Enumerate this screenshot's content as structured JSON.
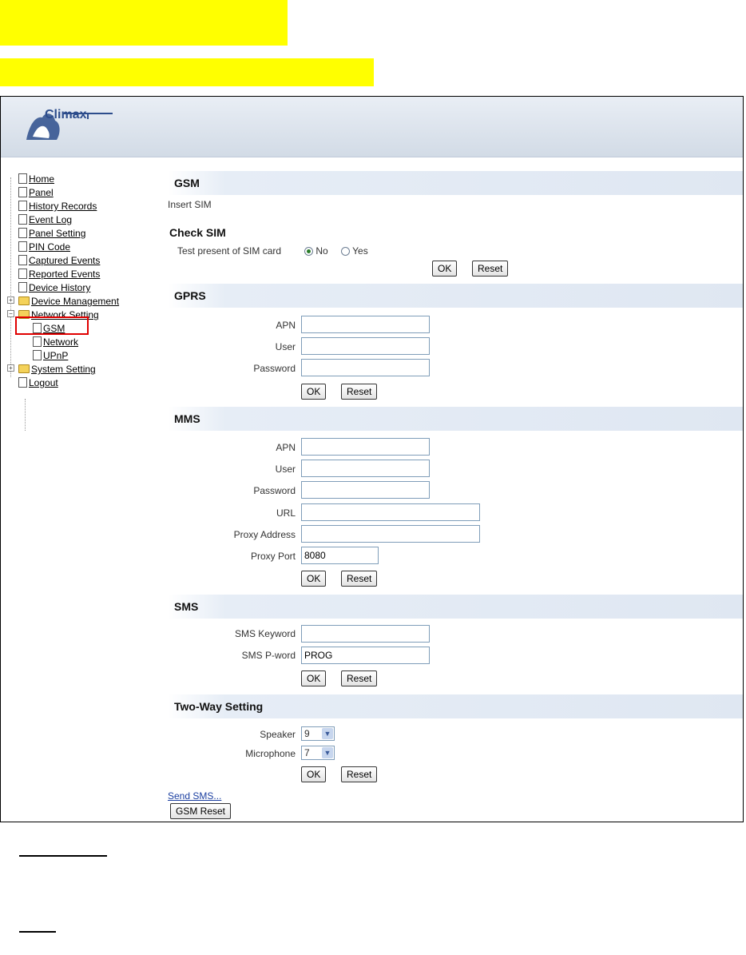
{
  "brand": {
    "name": "Climax"
  },
  "nav": {
    "items": [
      {
        "label": "Home"
      },
      {
        "label": "Panel"
      },
      {
        "label": "History Records"
      },
      {
        "label": "Event Log"
      },
      {
        "label": "Panel Setting"
      },
      {
        "label": "PIN Code"
      },
      {
        "label": "Captured Events"
      },
      {
        "label": "Reported Events"
      },
      {
        "label": "Device History"
      },
      {
        "label": "Device Management"
      },
      {
        "label": "Network Setting"
      },
      {
        "label": "GSM"
      },
      {
        "label": "Network"
      },
      {
        "label": "UPnP"
      },
      {
        "label": "System Setting"
      },
      {
        "label": "Logout"
      }
    ]
  },
  "gsm": {
    "title": "GSM",
    "insert_sim": "Insert SIM",
    "check_sim_title": "Check SIM",
    "test_label": "Test present of SIM card",
    "radio_no": "No",
    "radio_yes": "Yes",
    "ok": "OK",
    "reset": "Reset"
  },
  "gprs": {
    "title": "GPRS",
    "apn_label": "APN",
    "apn_value": "",
    "user_label": "User",
    "user_value": "",
    "password_label": "Password",
    "password_value": "",
    "ok": "OK",
    "reset": "Reset"
  },
  "mms": {
    "title": "MMS",
    "apn_label": "APN",
    "apn_value": "",
    "user_label": "User",
    "user_value": "",
    "password_label": "Password",
    "password_value": "",
    "url_label": "URL",
    "url_value": "",
    "proxy_address_label": "Proxy Address",
    "proxy_address_value": "",
    "proxy_port_label": "Proxy Port",
    "proxy_port_value": "8080",
    "ok": "OK",
    "reset": "Reset"
  },
  "sms": {
    "title": "SMS",
    "keyword_label": "SMS Keyword",
    "keyword_value": "",
    "pword_label": "SMS P-word",
    "pword_value": "PROG",
    "ok": "OK",
    "reset": "Reset"
  },
  "two_way": {
    "title": "Two-Way Setting",
    "speaker_label": "Speaker",
    "speaker_value": "9",
    "microphone_label": "Microphone",
    "microphone_value": "7",
    "ok": "OK",
    "reset": "Reset"
  },
  "footer": {
    "send_sms": "Send SMS...",
    "gsm_reset": "GSM Reset"
  },
  "colors": {
    "highlight": "#ffff00",
    "section_bg": "#dfe7f2",
    "link": "#1a3ea0",
    "selection_box": "#e00000"
  }
}
